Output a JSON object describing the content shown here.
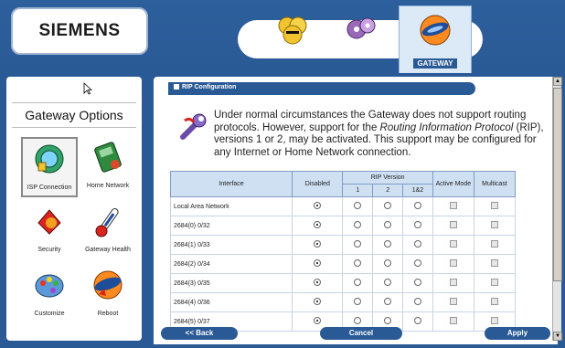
{
  "header": {
    "brand": "SIEMENS",
    "nav": [
      {
        "label": "USERS",
        "icon": "users-icon"
      },
      {
        "label": "DEVICES",
        "icon": "devices-icon"
      },
      {
        "label": "GATEWAY",
        "icon": "gateway-icon",
        "active": true
      }
    ]
  },
  "sidebar": {
    "title": "Gateway Options",
    "options": [
      {
        "label": "ISP Connection",
        "icon": "isp-connection-icon",
        "selected": true
      },
      {
        "label": "Home Network",
        "icon": "home-network-icon"
      },
      {
        "label": "Security",
        "icon": "security-icon"
      },
      {
        "label": "Gateway Health",
        "icon": "gateway-health-icon"
      },
      {
        "label": "Customize",
        "icon": "customize-icon"
      },
      {
        "label": "Reboot",
        "icon": "reboot-icon"
      }
    ]
  },
  "content": {
    "section_title": "RIP Configuration",
    "intro_1": "Under normal circumstances the Gateway does not support routing protocols. However, support for the ",
    "intro_em": "Routing Information Protocol",
    "intro_2": " (RIP), versions 1 or 2, may be activated. This support may be configured for any Internet or Home Network connection.",
    "table": {
      "headers": {
        "interface": "Interface",
        "disabled": "Disabled",
        "rip_version": "RIP Version",
        "v1": "1",
        "v2": "2",
        "v12": "1&2",
        "active_mode": "Active Mode",
        "multicast": "Multicast"
      },
      "rows": [
        {
          "interface": "Local Area Network",
          "selected": "disabled"
        },
        {
          "interface": "2684(0) 0/32",
          "selected": "disabled"
        },
        {
          "interface": "2684(1) 0/33",
          "selected": "disabled"
        },
        {
          "interface": "2684(2) 0/34",
          "selected": "disabled"
        },
        {
          "interface": "2684(3) 0/35",
          "selected": "disabled"
        },
        {
          "interface": "2684(4) 0/36",
          "selected": "disabled"
        },
        {
          "interface": "2684(5) 0/37",
          "selected": "disabled"
        }
      ]
    }
  },
  "footer": {
    "back_label": "<< Back",
    "cancel_label": "Cancel",
    "apply_label": "Apply"
  },
  "colors": {
    "frame_blue": "#2a5a96",
    "table_header": "#cfe0f3"
  }
}
